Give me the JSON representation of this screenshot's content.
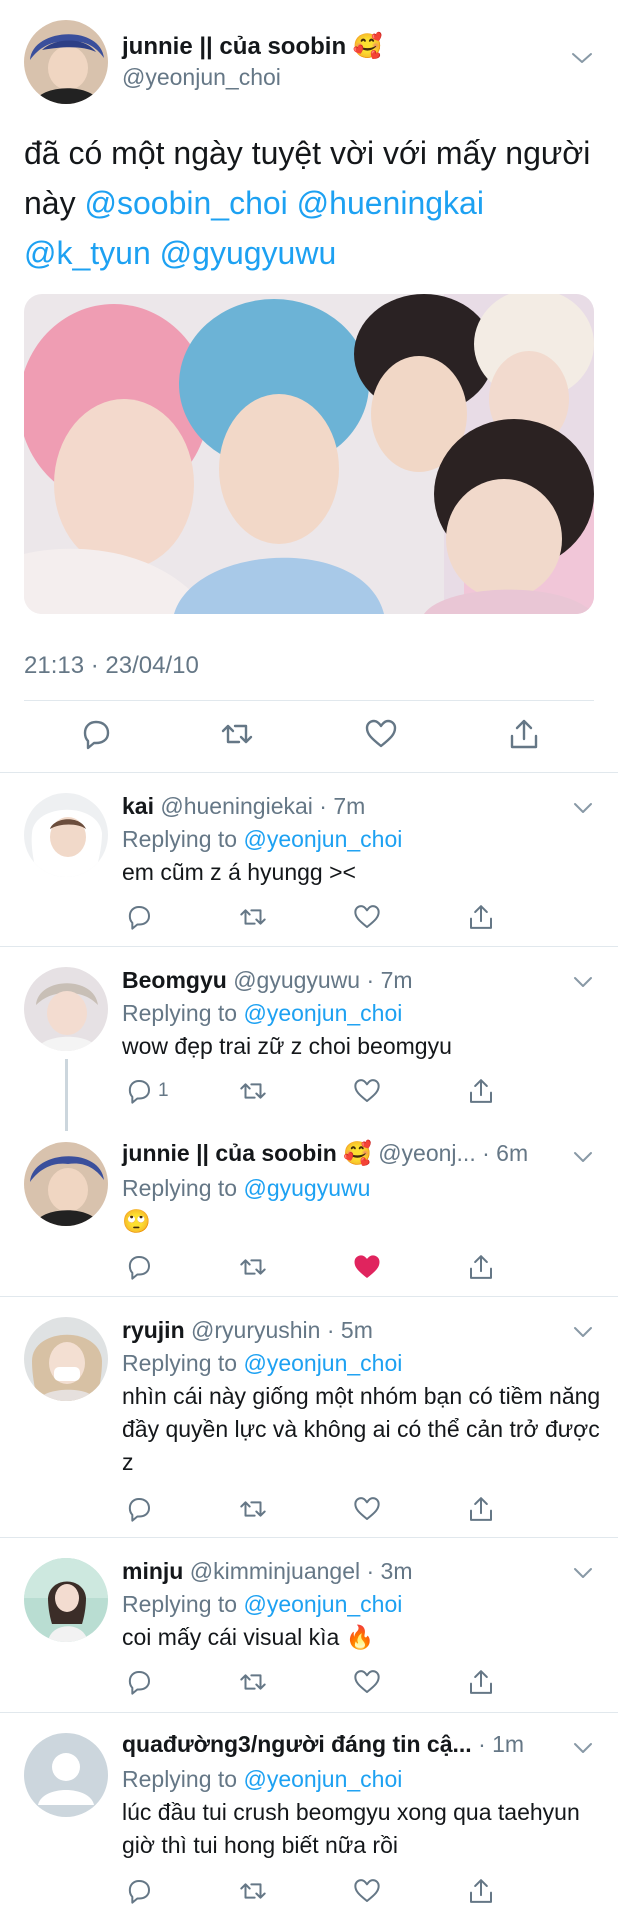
{
  "main_tweet": {
    "author_name": "junnie || của soobin 🥰",
    "author_handle": "@yeonjun_choi",
    "text_plain": "đã có một ngày tuyệt vời với mấy người này ",
    "mentions": [
      "@soobin_choi",
      "@hueningkai",
      "@k_tyun",
      "@gyugyuwu"
    ],
    "timestamp": "21:13 · 23/04/10"
  },
  "replies": [
    {
      "name": "kai",
      "handle": "@hueningiekai",
      "time": "7m",
      "replying_label": "Replying to ",
      "replying_to": "@yeonjun_choi",
      "text": "em cũm z á hyungg ><",
      "reply_count": "",
      "liked": false
    },
    {
      "name": "Beomgyu",
      "handle": "@gyugyuwu",
      "time": "7m",
      "replying_label": "Replying to ",
      "replying_to": "@yeonjun_choi",
      "text": "wow đẹp trai zữ z choi beomgyu",
      "reply_count": "1",
      "liked": false
    },
    {
      "name": "junnie || của soobin 🥰",
      "handle": "@yeonj...",
      "time": "6m",
      "replying_label": "Replying to ",
      "replying_to": "@gyugyuwu",
      "text": "🙄",
      "reply_count": "",
      "liked": true
    },
    {
      "name": "ryujin",
      "handle": "@ryuryushin",
      "time": "5m",
      "replying_label": "Replying to ",
      "replying_to": "@yeonjun_choi",
      "text": "nhìn cái này giống một nhóm bạn có tiềm năng đầy quyền lực và không ai có thể cản trở được z",
      "reply_count": "",
      "liked": false
    },
    {
      "name": "minju",
      "handle": "@kimminjuangel",
      "time": "3m",
      "replying_label": "Replying to ",
      "replying_to": "@yeonjun_choi",
      "text": "coi mấy cái visual kìa 🔥",
      "reply_count": "",
      "liked": false
    },
    {
      "name": "quađường3/người đáng tin cậ...",
      "handle": "",
      "time": "1m",
      "replying_label": "Replying to ",
      "replying_to": "@yeonjun_choi",
      "text": "lúc đầu tui crush beomgyu xong qua taehyun giờ thì tui hong biết nữa rồi",
      "reply_count": "",
      "liked": false
    }
  ],
  "colors": {
    "link": "#1da1f2",
    "secondary_text": "#657786",
    "like_red": "#e0245e",
    "divider": "#e1e8ed"
  },
  "icons": [
    "reply-icon",
    "retweet-icon",
    "like-icon",
    "share-icon",
    "chevron-down-icon"
  ]
}
